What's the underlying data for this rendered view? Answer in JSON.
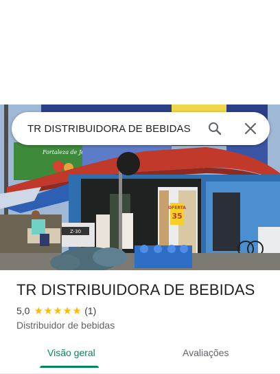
{
  "search": {
    "query": "TR DISTRIBUIDORA DE BEBIDAS"
  },
  "photo": {
    "signage": [
      "Fortaleza de Jesus",
      "OFERTA",
      "35"
    ],
    "dispenser_label": "Z-30"
  },
  "place": {
    "name": "TR DISTRIBUIDORA DE BEBIDAS",
    "rating": "5,0",
    "stars": 5,
    "review_count": "(1)",
    "category": "Distribuidor de bebidas"
  },
  "tabs": [
    {
      "label": "Visão geral",
      "active": true
    },
    {
      "label": "Avaliações",
      "active": false
    }
  ],
  "colors": {
    "accent": "#01875f",
    "star": "#fbbc04",
    "awning": "#c0392b"
  }
}
